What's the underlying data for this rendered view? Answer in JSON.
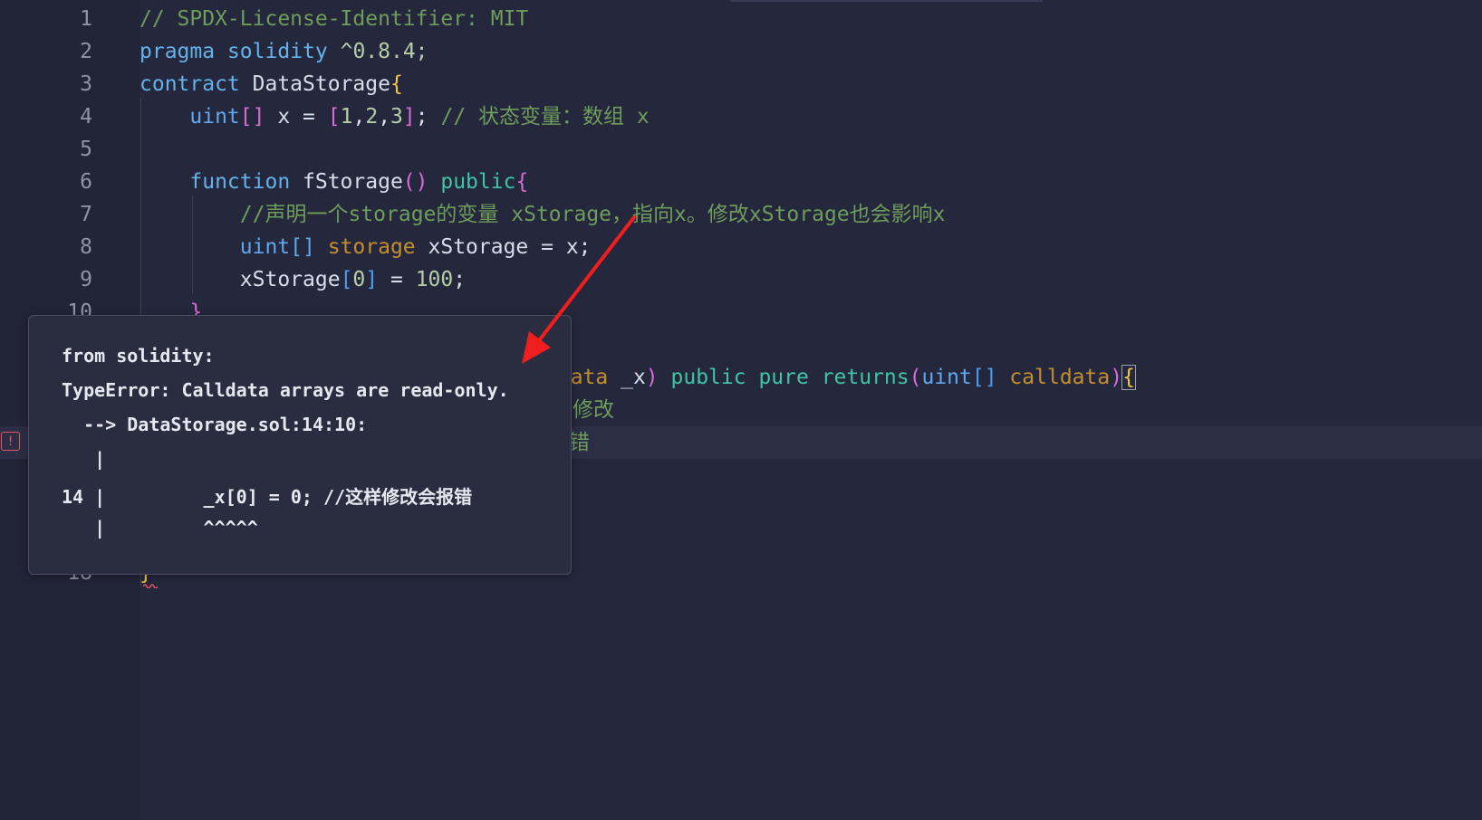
{
  "line_numbers": [
    "1",
    "2",
    "3",
    "4",
    "5",
    "6",
    "7",
    "8",
    "9",
    "10",
    "18"
  ],
  "lines": {
    "l1": {
      "comment": "// SPDX-License-Identifier: MIT"
    },
    "l2": {
      "kw1": "pragma",
      "kw2": "solidity",
      "ver": "^0.8.4;"
    },
    "l3": {
      "kw": "contract",
      "name": "DataStorage",
      "brace": "{"
    },
    "l4": {
      "type": "uint",
      "lb": "[",
      "rb": "]",
      "rest": " x = ",
      "alb": "[",
      "n1": "1",
      "c1": ",",
      "n2": "2",
      "c2": ",",
      "n3": "3",
      "arb": "]",
      "semi": "; ",
      "comment": "// 状态变量：数组 x"
    },
    "l6": {
      "kw": "function",
      "name": " fStorage",
      "paren": "()",
      "pub": " public",
      "brace": "{"
    },
    "l7": {
      "comment": "//声明一个storage的变量 xStorage，指向x。修改xStorage也会影响x"
    },
    "l8": {
      "type": "uint[]",
      "storage": " storage",
      "rest": " xStorage = x;"
    },
    "l9": {
      "name": "xStorage",
      "lb": "[",
      "idx": "0",
      "rb": "]",
      "rest": " = ",
      "val": "100",
      "semi": ";"
    },
    "l10": {
      "brace": "}"
    },
    "l12": {
      "kw": "ldata",
      "p1": " _x",
      "cp": ")",
      "pub": " public",
      "pure": " pure",
      "ret": " returns",
      "op": "(",
      "type": "uint",
      "ab": "[]",
      "cd": " calldata",
      "cp2": ")",
      "brace": "{"
    },
    "l13": {
      "comment": "修改"
    },
    "l14": {
      "comment": "错"
    },
    "l18": {
      "brace": "}"
    }
  },
  "hover": {
    "source": "from solidity:",
    "error": "TypeError: Calldata arrays are read-only.",
    "location": "  --> DataStorage.sol:14:10:",
    "pipe1": "   |",
    "code_line": "14 |         _x[0] = 0; //这样修改会报错",
    "pipe3": "   |         ^^^^^"
  },
  "error_marker": "!",
  "colors": {
    "background": "#25273c",
    "comment": "#6d9c5b",
    "keyword": "#63b2ea",
    "error": "#e05565",
    "arrow": "#f01e1e"
  }
}
